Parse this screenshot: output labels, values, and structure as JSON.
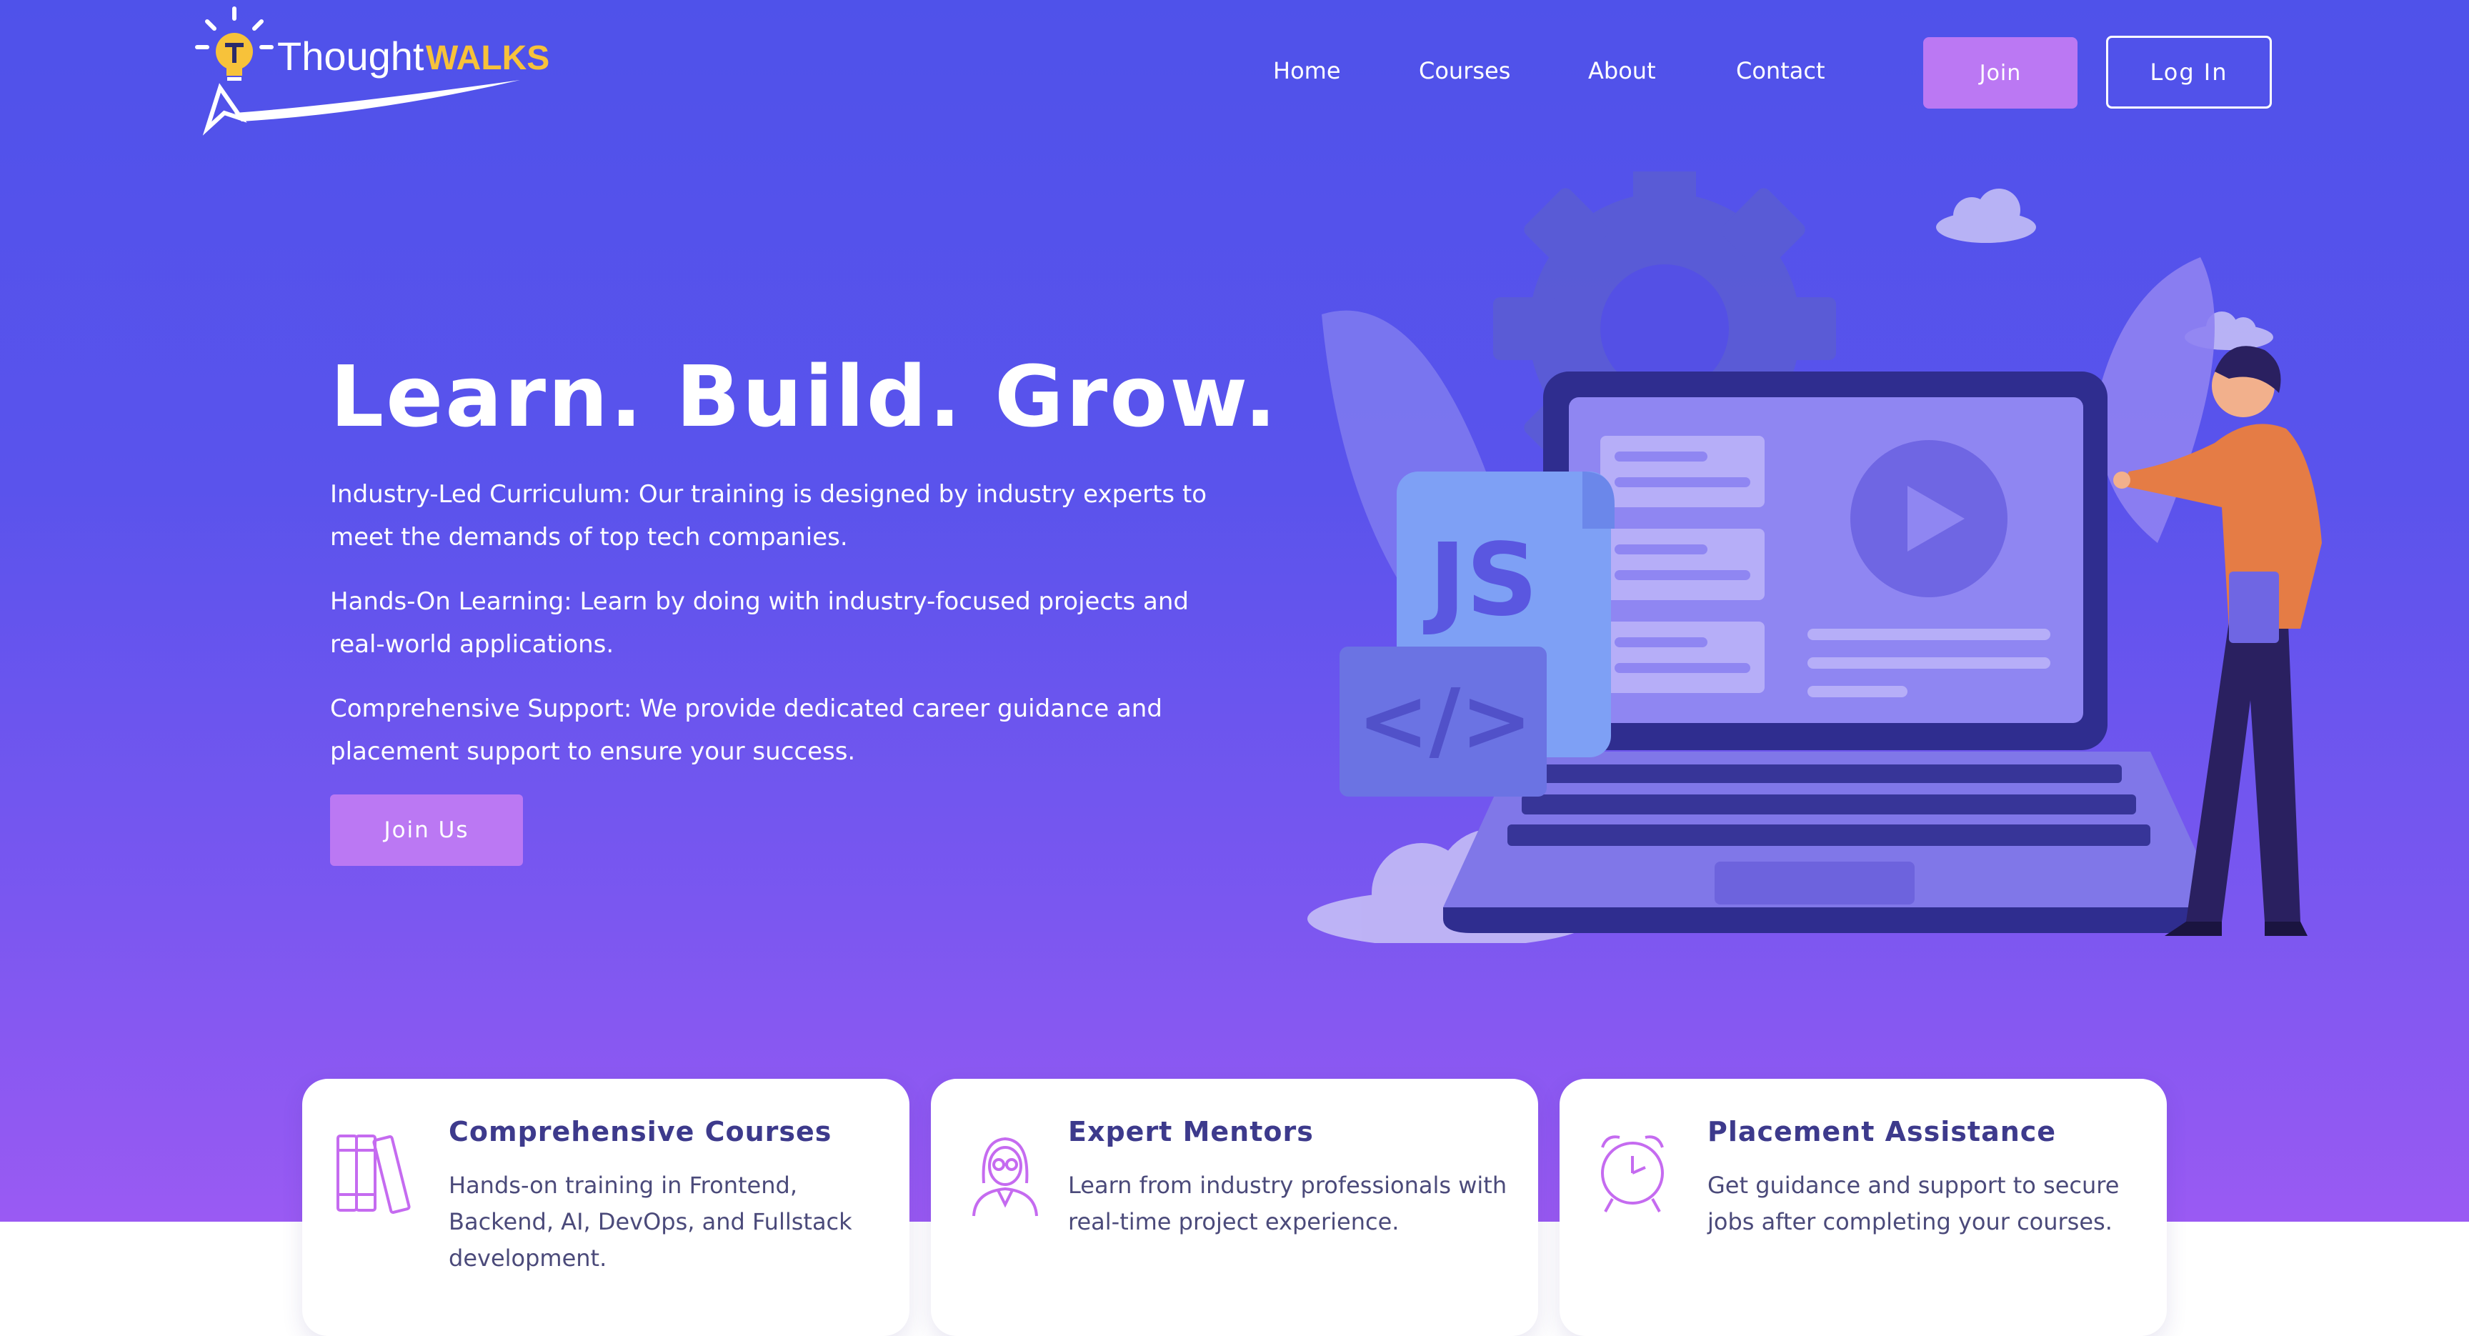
{
  "brand": {
    "name_part1": "Thought",
    "name_part2": "WALKS",
    "accent_color": "#f7c23a"
  },
  "nav": {
    "items": [
      {
        "label": "Home"
      },
      {
        "label": "Courses"
      },
      {
        "label": "About"
      },
      {
        "label": "Contact"
      }
    ],
    "join_label": "Join",
    "login_label": "Log In"
  },
  "hero": {
    "title": "Learn. Build. Grow.",
    "paragraphs": [
      "Industry-Led Curriculum: Our training is designed by industry experts to meet the demands of top tech companies.",
      "Hands-On Learning: Learn by doing with industry-focused projects and real-world applications.",
      "Comprehensive Support: We provide dedicated career guidance and placement support to ensure your success."
    ],
    "cta_label": "Join Us",
    "illustration_badge": "JS",
    "illustration_code": "</>"
  },
  "features": [
    {
      "icon": "books-icon",
      "title": "Comprehensive Courses",
      "description": "Hands-on training in Frontend, Backend, AI, DevOps, and Fullstack development."
    },
    {
      "icon": "mentor-icon",
      "title": "Expert Mentors",
      "description": "Learn from industry professionals with real-time project experience."
    },
    {
      "icon": "alarm-clock-icon",
      "title": "Placement Assistance",
      "description": "Get guidance and support to secure jobs after completing your courses."
    }
  ],
  "colors": {
    "hero_gradient_top": "#4f52ea",
    "hero_gradient_bottom": "#9a5af3",
    "button": "#bb78f3",
    "card_title": "#3d3a8c",
    "icon_stroke": "#c56bf0"
  }
}
